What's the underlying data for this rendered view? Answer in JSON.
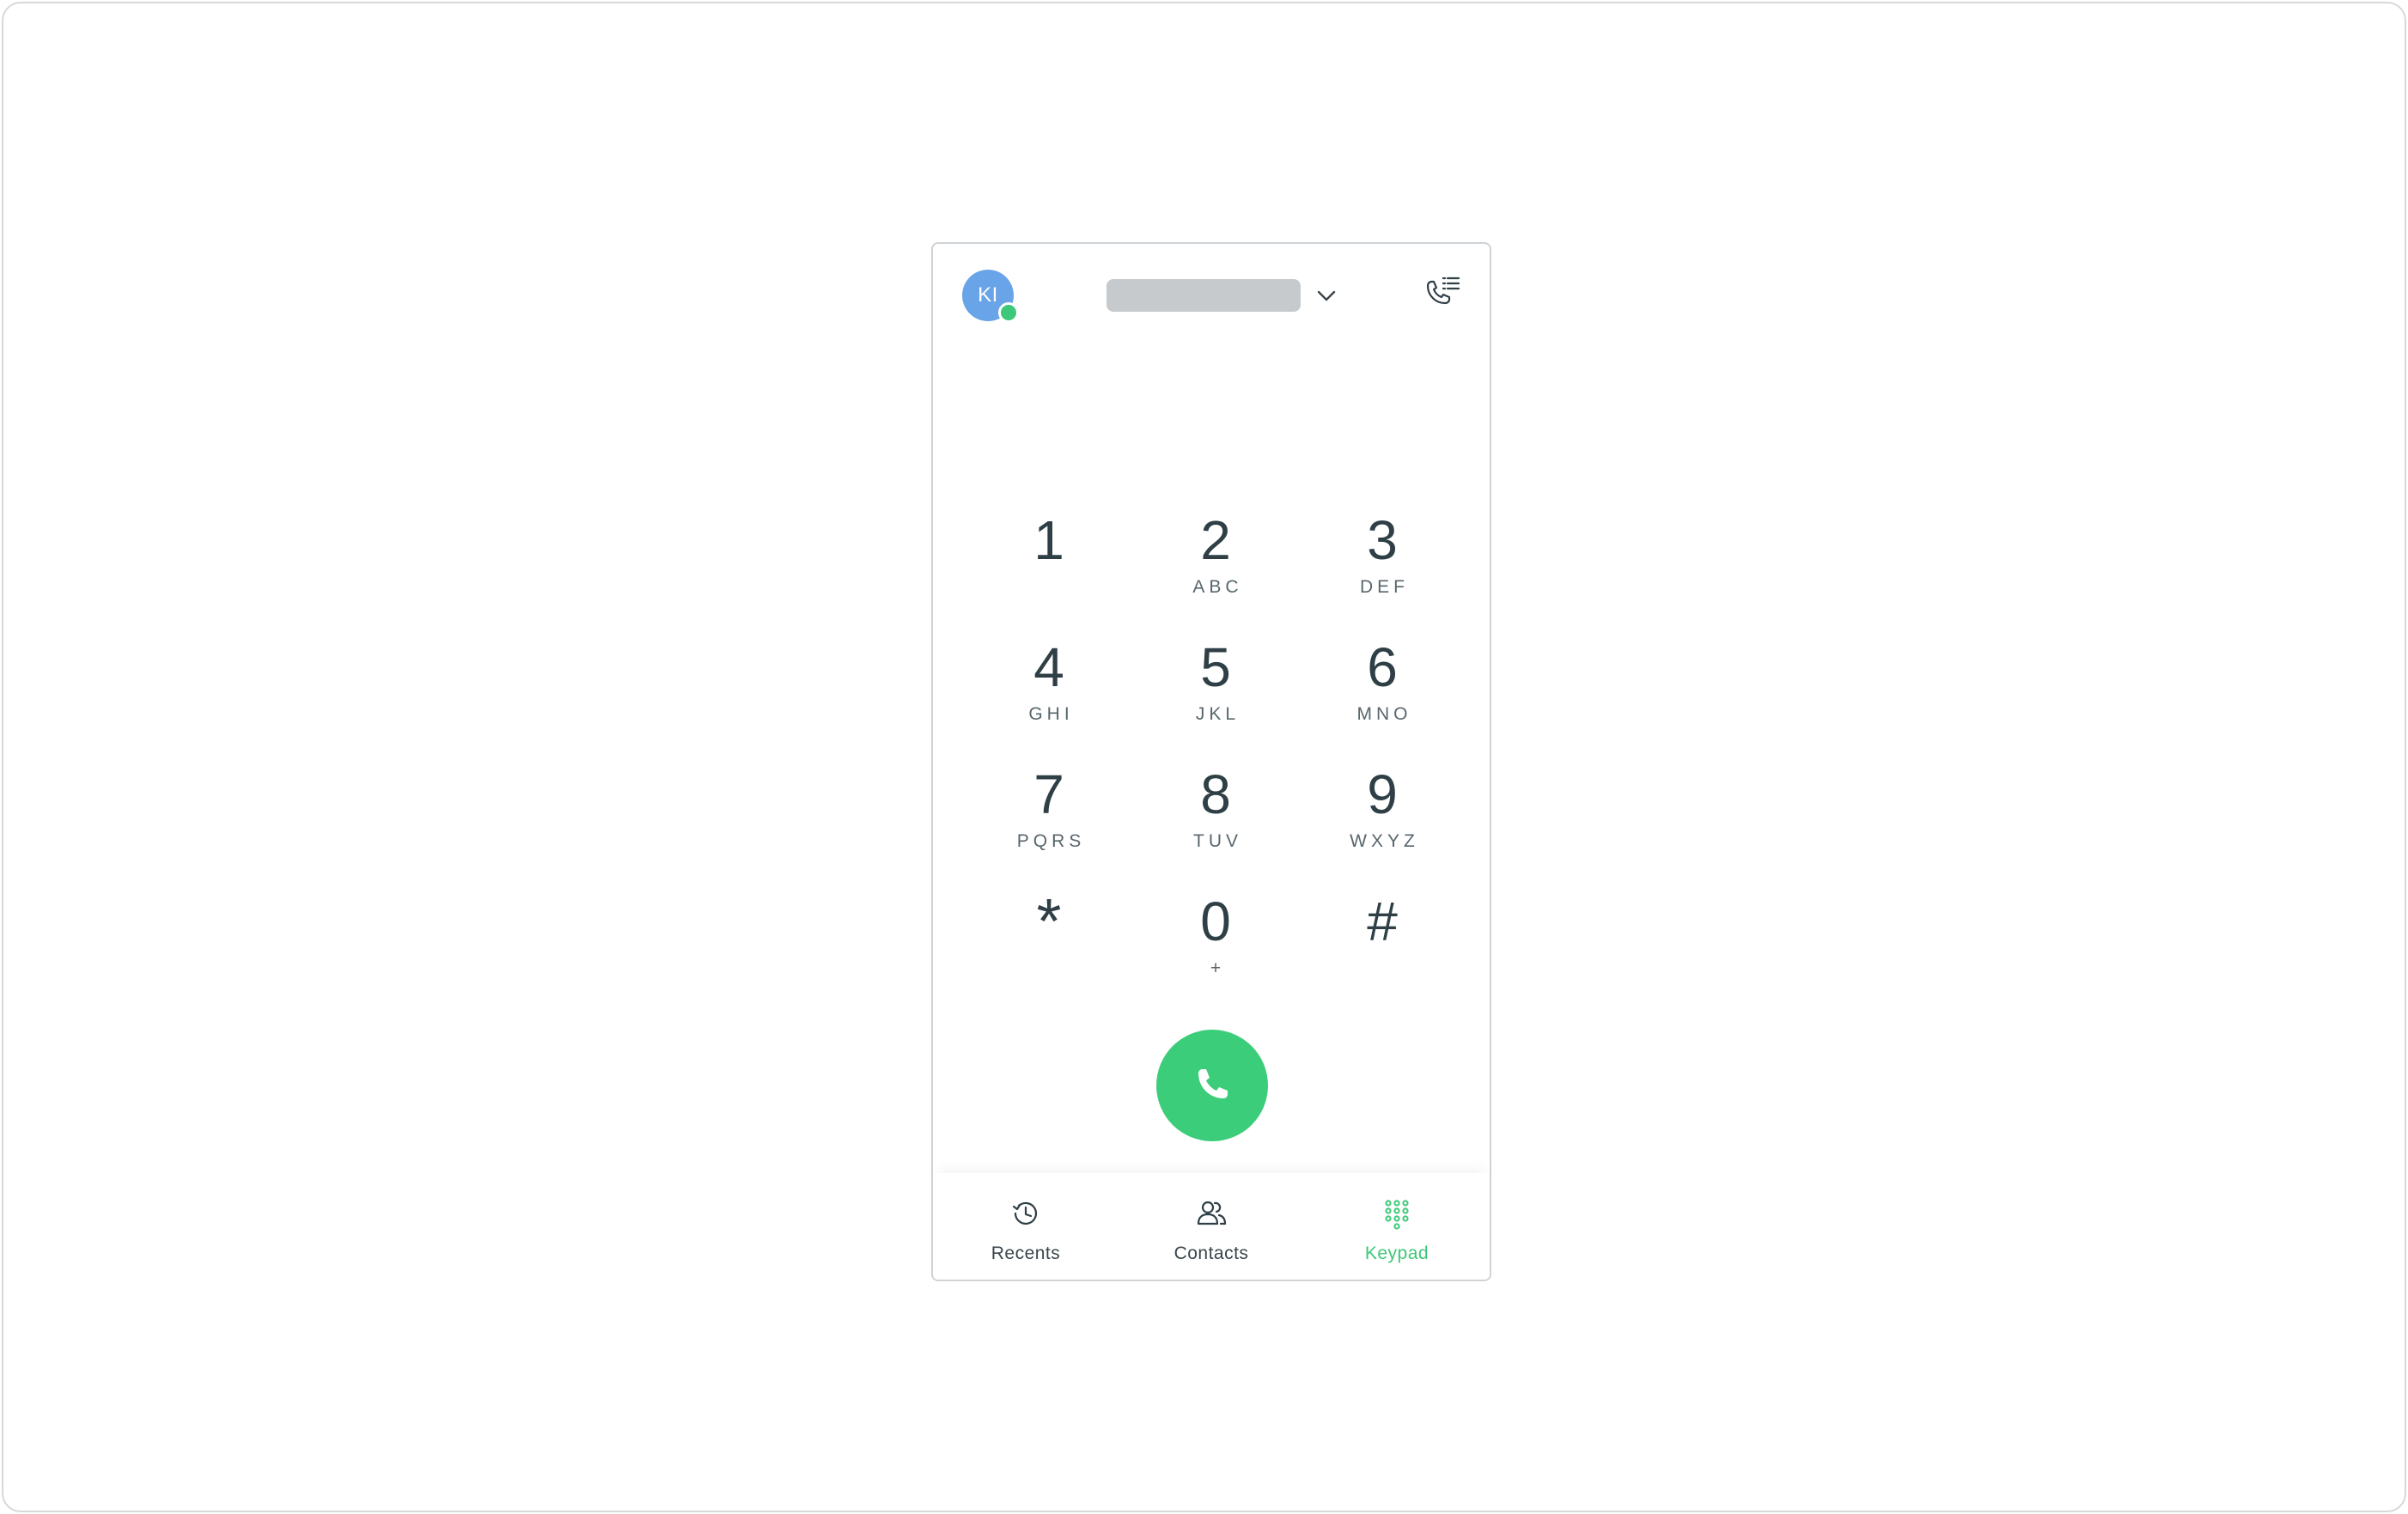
{
  "colors": {
    "accent": "#3cc878",
    "call_button": "#3ccd7a",
    "avatar": "#69a3e8",
    "text": "#2f3f46"
  },
  "header": {
    "avatar_initials": "KI",
    "presence_status": "online",
    "line_selector_icon": "chevron-down-icon",
    "call_history_icon": "phone-list-icon"
  },
  "keypad": {
    "keys": [
      {
        "digit": "1",
        "letters": ""
      },
      {
        "digit": "2",
        "letters": "ABC"
      },
      {
        "digit": "3",
        "letters": "DEF"
      },
      {
        "digit": "4",
        "letters": "GHI"
      },
      {
        "digit": "5",
        "letters": "JKL"
      },
      {
        "digit": "6",
        "letters": "MNO"
      },
      {
        "digit": "7",
        "letters": "PQRS"
      },
      {
        "digit": "8",
        "letters": "TUV"
      },
      {
        "digit": "9",
        "letters": "WXYZ"
      },
      {
        "digit": "*",
        "letters": ""
      },
      {
        "digit": "0",
        "letters": "+"
      },
      {
        "digit": "#",
        "letters": ""
      }
    ],
    "call_icon": "phone-icon"
  },
  "nav": {
    "items": [
      {
        "label": "Recents",
        "icon": "history-icon",
        "active": false
      },
      {
        "label": "Contacts",
        "icon": "contacts-icon",
        "active": false
      },
      {
        "label": "Keypad",
        "icon": "keypad-icon",
        "active": true
      }
    ]
  }
}
